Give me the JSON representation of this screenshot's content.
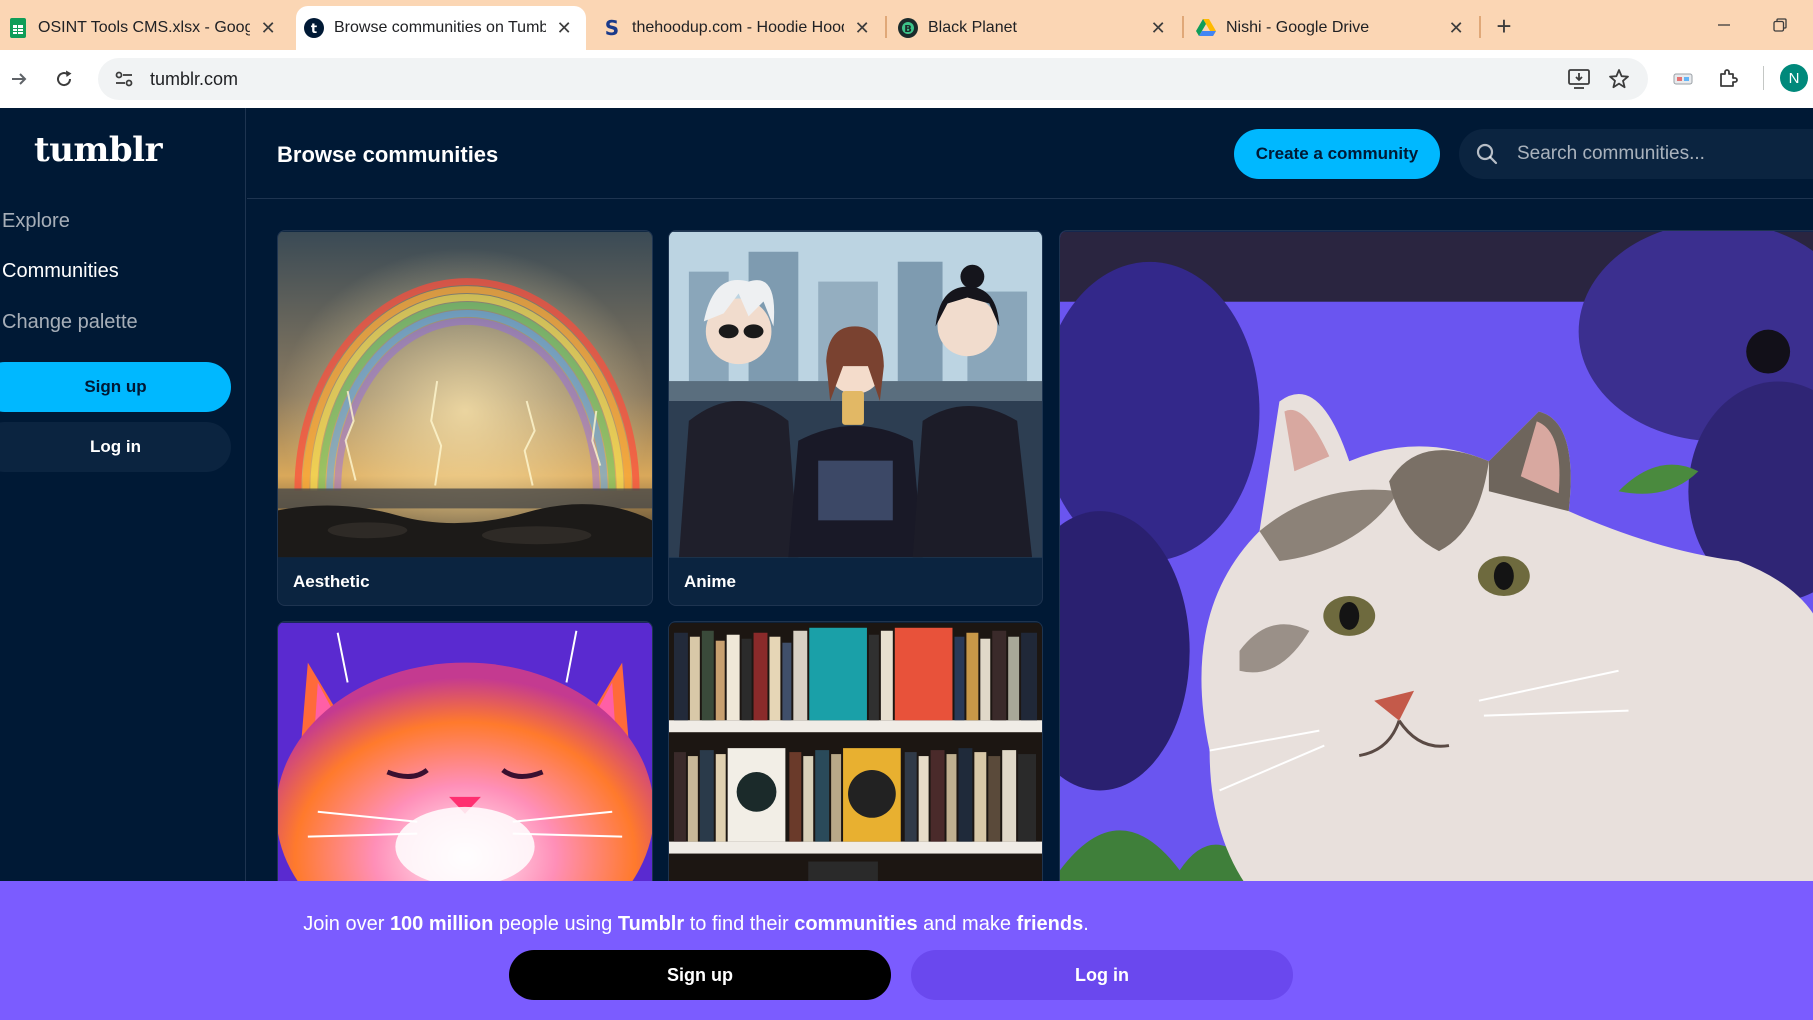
{
  "browser": {
    "tabs": [
      {
        "title": "OSINT Tools CMS.xlsx - Google",
        "icon": "sheets-icon"
      },
      {
        "title": "Browse communities on Tumblr",
        "icon": "tumblr-icon"
      },
      {
        "title": "thehoodup.com - Hoodie Hood",
        "icon": "s-logo-icon"
      },
      {
        "title": "Black Planet",
        "icon": "blackplanet-icon"
      },
      {
        "title": "Nishi - Google Drive",
        "icon": "drive-icon"
      }
    ],
    "active_tab": 1,
    "url": "tumblr.com",
    "profile_initial": "N"
  },
  "sidebar": {
    "logo": "tumblr",
    "links": [
      {
        "label": "Explore"
      },
      {
        "label": "Communities"
      },
      {
        "label": "Change palette"
      }
    ],
    "signup_label": "Sign up",
    "login_label": "Log in"
  },
  "header": {
    "title": "Browse communities",
    "create_label": "Create a community",
    "search_placeholder": "Search communities..."
  },
  "communities": [
    {
      "name": "Aesthetic"
    },
    {
      "name": "Anime"
    }
  ],
  "join_bar": {
    "text_1": "Join over ",
    "bold_1": "100 million",
    "text_2": " people using ",
    "bold_2": "Tumblr",
    "text_3": " to find their ",
    "bold_3": "communities",
    "text_4": " and make ",
    "bold_4": "friends",
    "text_5": ".",
    "signup_label": "Sign up",
    "login_label": "Log in"
  },
  "colors": {
    "navy": "#001935",
    "accent_blue": "#00b8ff",
    "join_purple": "#7b5cff",
    "tab_strip": "#fbd6b4"
  }
}
